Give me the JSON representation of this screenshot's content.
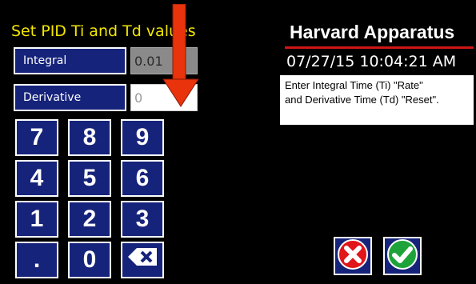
{
  "screen": {
    "title": "Set PID Ti and Td values"
  },
  "fields": [
    {
      "label": "Integral",
      "value": "0.01"
    },
    {
      "label": "Derivative",
      "value": "0"
    }
  ],
  "keypad": {
    "keys": [
      "7",
      "8",
      "9",
      "4",
      "5",
      "6",
      "1",
      "2",
      "3",
      ".",
      "0"
    ],
    "backspace_icon": "backspace-icon"
  },
  "header": {
    "brand": "Harvard Apparatus",
    "datetime": "07/27/15 10:04:21 AM"
  },
  "help": {
    "line1": "Enter Integral Time (Ti) \"Rate\"",
    "line2": "and Derivative Time (Td) \"Reset\"."
  },
  "actions": {
    "cancel_icon": "cancel-x-icon",
    "confirm_icon": "confirm-check-icon"
  },
  "colors": {
    "title_yellow": "#f2e600",
    "button_navy": "#16237a",
    "brand_rule_red": "#d11515",
    "cancel_red": "#e0161b",
    "confirm_green": "#1ea33a",
    "annotation_arrow": "#e8330c"
  }
}
